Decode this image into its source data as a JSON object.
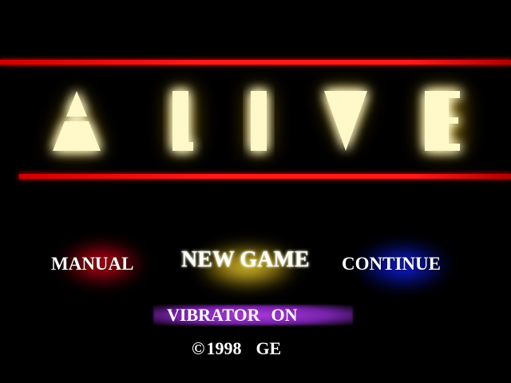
{
  "game": {
    "title": "ALIVE"
  },
  "menu": {
    "items": [
      {
        "label": "MANUAL",
        "glow_color": "#e00014"
      },
      {
        "label": "NEW GAME",
        "glow_color": "#ffe63c",
        "selected": true
      },
      {
        "label": "CONTINUE",
        "glow_color": "#1428ff"
      }
    ]
  },
  "option": {
    "label": "VIBRATOR",
    "value": "ON",
    "bar_color": "#b43ce6"
  },
  "footer": {
    "copyright_symbol": "©",
    "year": "1998",
    "owner": "GE"
  },
  "colors": {
    "background": "#000000",
    "accent_line": "#ff1a1a",
    "logo_glow": "#ffe84a",
    "text": "#ffffff"
  }
}
